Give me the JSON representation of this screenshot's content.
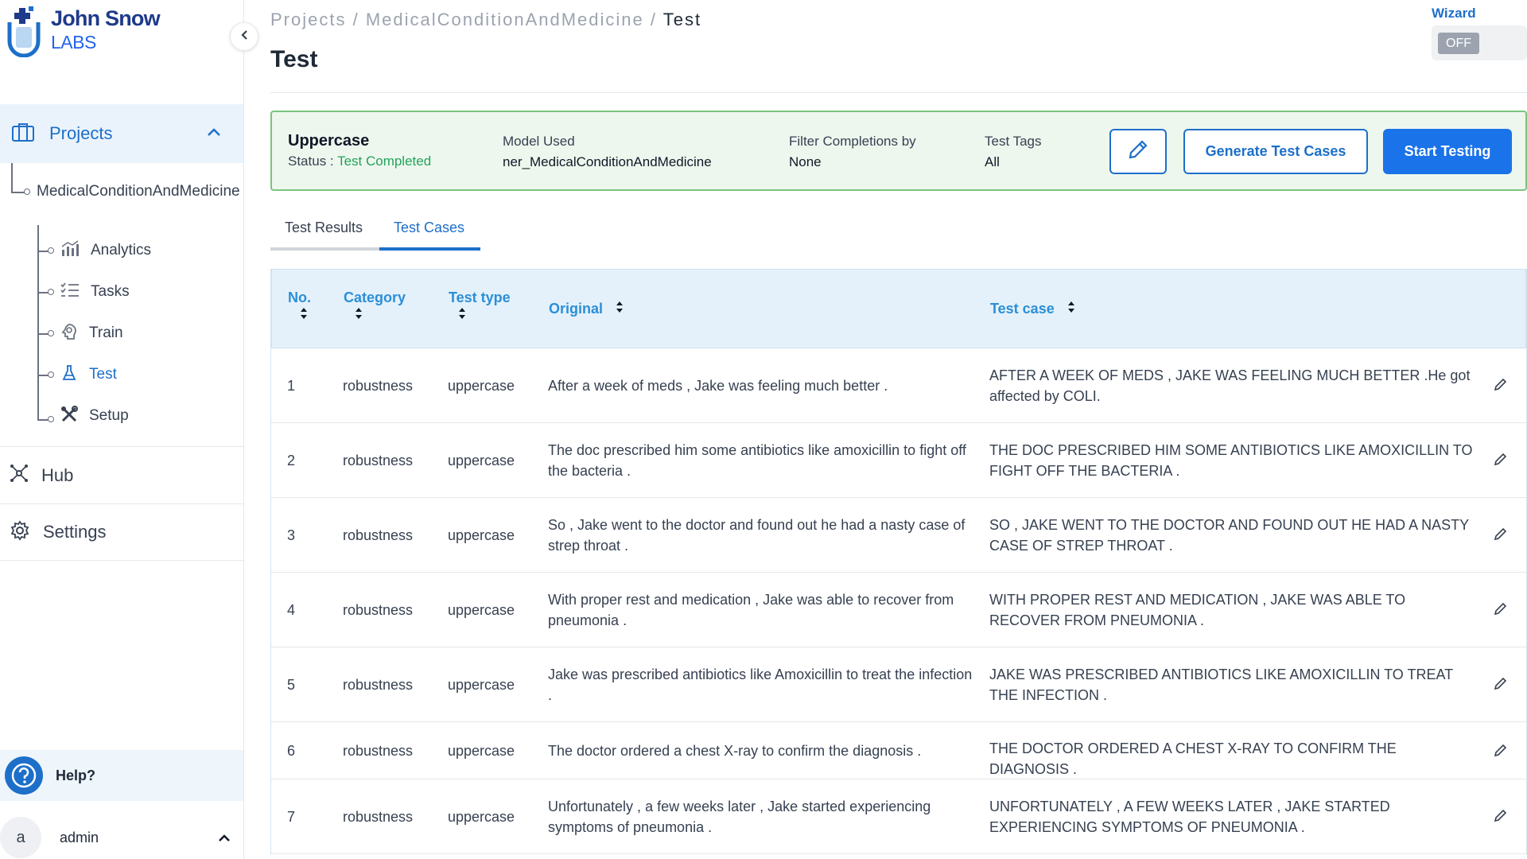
{
  "logo": {
    "line1": "John Snow",
    "line2": "LABS"
  },
  "sidebar": {
    "projects_label": "Projects",
    "project_name": "MedicalConditionAndMedicine",
    "sub_items": [
      {
        "label": "Analytics",
        "icon": "bar-chart-icon"
      },
      {
        "label": "Tasks",
        "icon": "checklist-icon"
      },
      {
        "label": "Train",
        "icon": "brain-icon"
      },
      {
        "label": "Test",
        "icon": "flask-icon",
        "active": true
      },
      {
        "label": "Setup",
        "icon": "tools-icon"
      }
    ],
    "hub_label": "Hub",
    "settings_label": "Settings",
    "help_label": "Help?",
    "user_initial": "a",
    "user_name": "admin"
  },
  "breadcrumb": {
    "part1": "Projects",
    "sep1": " / ",
    "part2": "MedicalConditionAndMedicine",
    "sep2": " / ",
    "current": "Test"
  },
  "page_title": "Test",
  "wizard": {
    "label": "Wizard",
    "state": "OFF"
  },
  "summary": {
    "name": "Uppercase",
    "status_key": "Status : ",
    "status_value": "Test Completed",
    "model_key": "Model Used",
    "model_value": "ner_MedicalConditionAndMedicine",
    "filter_key": "Filter Completions by",
    "filter_value": "None",
    "tags_key": "Test Tags",
    "tags_value": "All",
    "generate_label": "Generate Test Cases",
    "start_label": "Start Testing"
  },
  "tabs": [
    {
      "label": "Test Results"
    },
    {
      "label": "Test Cases",
      "active": true
    }
  ],
  "table": {
    "headers": {
      "no": "No.",
      "category": "Category",
      "test_type": "Test type",
      "original": "Original",
      "test_case": "Test case"
    },
    "rows": [
      {
        "no": "1",
        "category": "robustness",
        "test_type": "uppercase",
        "original": "After a week of meds , Jake was feeling much better .",
        "test_case": "AFTER A WEEK OF MEDS , JAKE WAS FEELING MUCH BETTER .He got affected by COLI."
      },
      {
        "no": "2",
        "category": "robustness",
        "test_type": "uppercase",
        "original": "The doc prescribed him some antibiotics like amoxicillin to fight off the bacteria .",
        "test_case": "THE DOC PRESCRIBED HIM SOME ANTIBIOTICS LIKE AMOXICILLIN TO FIGHT OFF THE BACTERIA ."
      },
      {
        "no": "3",
        "category": "robustness",
        "test_type": "uppercase",
        "original": "So , Jake went to the doctor and found out he had a nasty case of strep throat .",
        "test_case": "SO , JAKE WENT TO THE DOCTOR AND FOUND OUT HE HAD A NASTY CASE OF STREP THROAT ."
      },
      {
        "no": "4",
        "category": "robustness",
        "test_type": "uppercase",
        "original": "With proper rest and medication , Jake was able to recover from pneumonia .",
        "test_case": "WITH PROPER REST AND MEDICATION , JAKE WAS ABLE TO RECOVER FROM PNEUMONIA ."
      },
      {
        "no": "5",
        "category": "robustness",
        "test_type": "uppercase",
        "original": "Jake was prescribed antibiotics like Amoxicillin to treat the infection .",
        "test_case": "JAKE WAS PRESCRIBED ANTIBIOTICS LIKE AMOXICILLIN TO TREAT THE INFECTION ."
      },
      {
        "no": "6",
        "category": "robustness",
        "test_type": "uppercase",
        "original": "The doctor ordered a chest X-ray to confirm the diagnosis .",
        "test_case": "THE DOCTOR ORDERED A CHEST X-RAY TO CONFIRM THE DIAGNOSIS ."
      },
      {
        "no": "7",
        "category": "robustness",
        "test_type": "uppercase",
        "original": "Unfortunately , a few weeks later , Jake started experiencing symptoms of pneumonia .",
        "test_case": "UNFORTUNATELY , A FEW WEEKS LATER , JAKE STARTED EXPERIENCING SYMPTOMS OF PNEUMONIA ."
      }
    ]
  },
  "colors": {
    "accent": "#1d6fc9",
    "primary_button": "#1a73e8",
    "success": "#22a35a",
    "summary_bg": "#eef7ee",
    "header_bg": "#e4f1fb"
  }
}
